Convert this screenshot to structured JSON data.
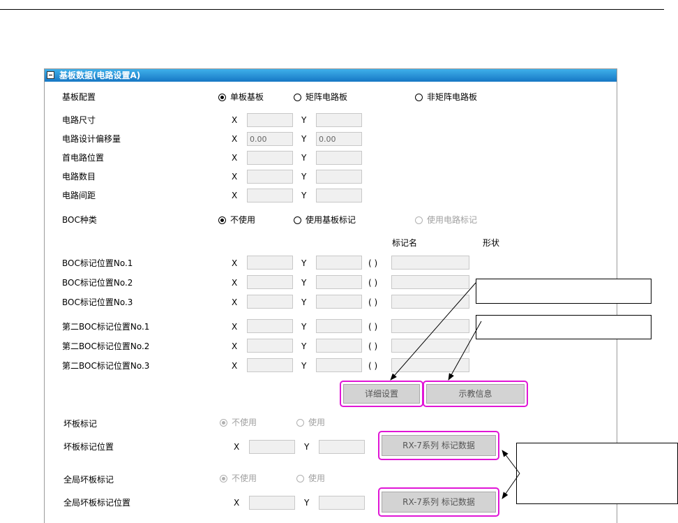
{
  "panel": {
    "title": "基板数据(电路设置A)"
  },
  "rows": {
    "layout": {
      "label": "基板配置",
      "options": [
        "单板基板",
        "矩阵电路板",
        "非矩阵电路板"
      ],
      "selected": "单板基板"
    },
    "size": {
      "label": "电路尺寸"
    },
    "offset": {
      "label": "电路设计偏移量",
      "x": "0.00",
      "y": "0.00"
    },
    "first_pos": {
      "label": "首电路位置"
    },
    "count": {
      "label": "电路数目"
    },
    "pitch": {
      "label": "电路间距"
    },
    "boc_type": {
      "label": "BOC种类",
      "options": [
        "不使用",
        "使用基板标记",
        "使用电路标记"
      ],
      "selected": "不使用"
    }
  },
  "axis": {
    "x": "X",
    "y": "Y",
    "paren": "( )"
  },
  "headers": {
    "mark_name": "标记名",
    "shape": "形状"
  },
  "boc_rows": [
    {
      "label": "BOC标记位置No.1"
    },
    {
      "label": "BOC标记位置No.2"
    },
    {
      "label": "BOC标记位置No.3"
    },
    {
      "label": "第二BOC标记位置No.1"
    },
    {
      "label": "第二BOC标记位置No.2"
    },
    {
      "label": "第二BOC标记位置No.3"
    }
  ],
  "buttons": {
    "detail": "详细设置",
    "teach": "示教信息",
    "rx7_1": "RX-7系列 标记数据",
    "rx7_2": "RX-7系列 标记数据"
  },
  "bad_mark": {
    "label": "坏板标记",
    "options": [
      "不使用",
      "使用"
    ],
    "selected": "不使用"
  },
  "bad_mark_pos": {
    "label": "坏板标记位置"
  },
  "global_bad": {
    "label": "全局坏板标记",
    "options": [
      "不使用",
      "使用"
    ],
    "selected": "不使用"
  },
  "global_bad_pos": {
    "label": "全局坏板标记位置"
  },
  "colors": {
    "title_bar": "#1677c4",
    "highlight": "#e016d6"
  }
}
